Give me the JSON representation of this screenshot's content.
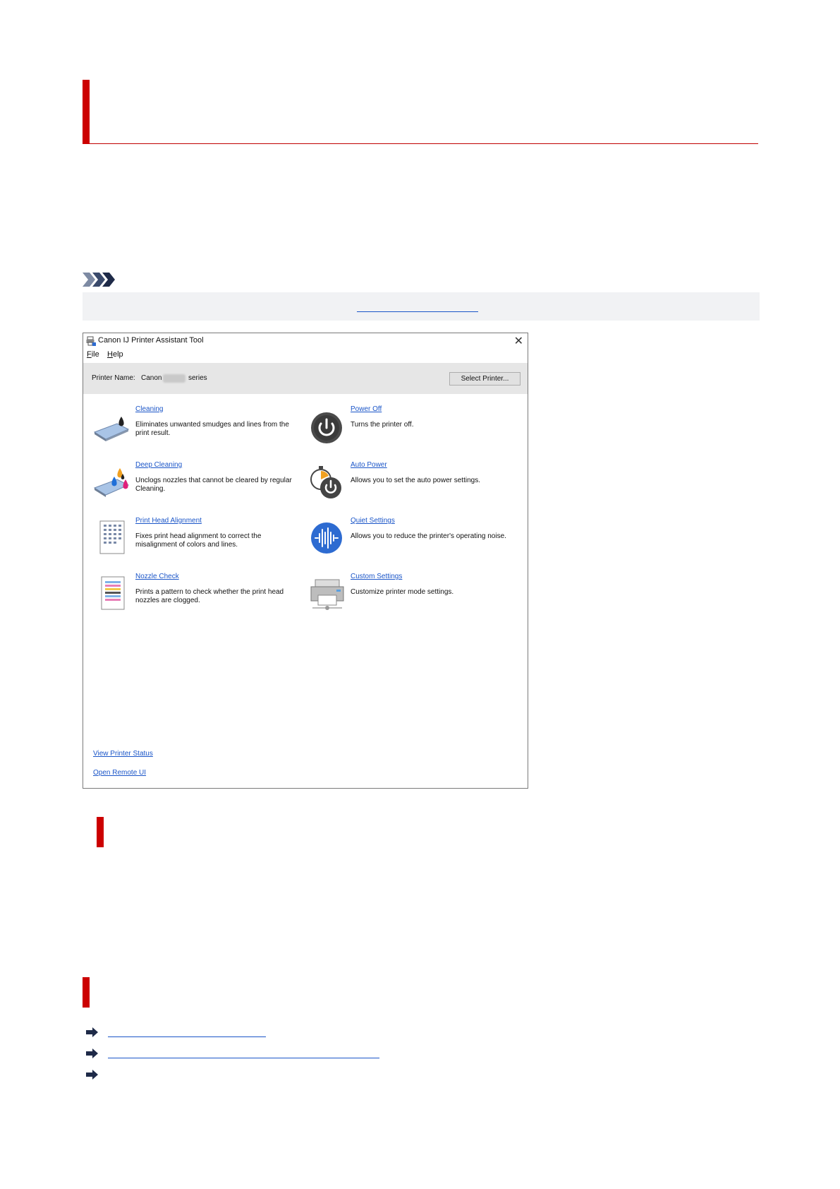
{
  "window": {
    "title": "Canon IJ Printer Assistant Tool",
    "close_glyph": "✕",
    "menu": [
      {
        "label_ul": "F",
        "label_rest": "ile"
      },
      {
        "label_ul": "H",
        "label_rest": "elp"
      }
    ],
    "printer_label": "Printer Name:",
    "printer_brand": "Canon",
    "printer_series": "series",
    "select_printer_label": "Select Printer...",
    "functions": [
      {
        "name": "Cleaning",
        "desc": "Eliminates unwanted smudges and lines from the print result.",
        "icon": "cleaning-icon"
      },
      {
        "name": "Power Off",
        "desc": "Turns the printer off.",
        "icon": "power-off-icon"
      },
      {
        "name": "Deep Cleaning",
        "desc": "Unclogs nozzles that cannot be cleared by regular Cleaning.",
        "icon": "deep-cleaning-icon"
      },
      {
        "name": "Auto Power",
        "desc": "Allows you to set the auto power settings.",
        "icon": "auto-power-icon"
      },
      {
        "name": "Print Head Alignment",
        "desc": "Fixes print head alignment to correct the misalignment of colors and lines.",
        "icon": "print-head-alignment-icon"
      },
      {
        "name": "Quiet Settings",
        "desc": "Allows you to reduce the printer's operating noise.",
        "icon": "quiet-settings-icon"
      },
      {
        "name": "Nozzle Check",
        "desc": "Prints a pattern to check whether the print head nozzles are clogged.",
        "icon": "nozzle-check-icon"
      },
      {
        "name": "Custom Settings",
        "desc": "Customize printer mode settings.",
        "icon": "custom-settings-icon"
      }
    ],
    "view_printer_status": "View Printer Status",
    "open_remote_ui": "Open Remote UI"
  },
  "colors": {
    "accent_red": "#cc0000",
    "link_blue": "#1a55c8",
    "note_bg": "#f1f2f4"
  }
}
